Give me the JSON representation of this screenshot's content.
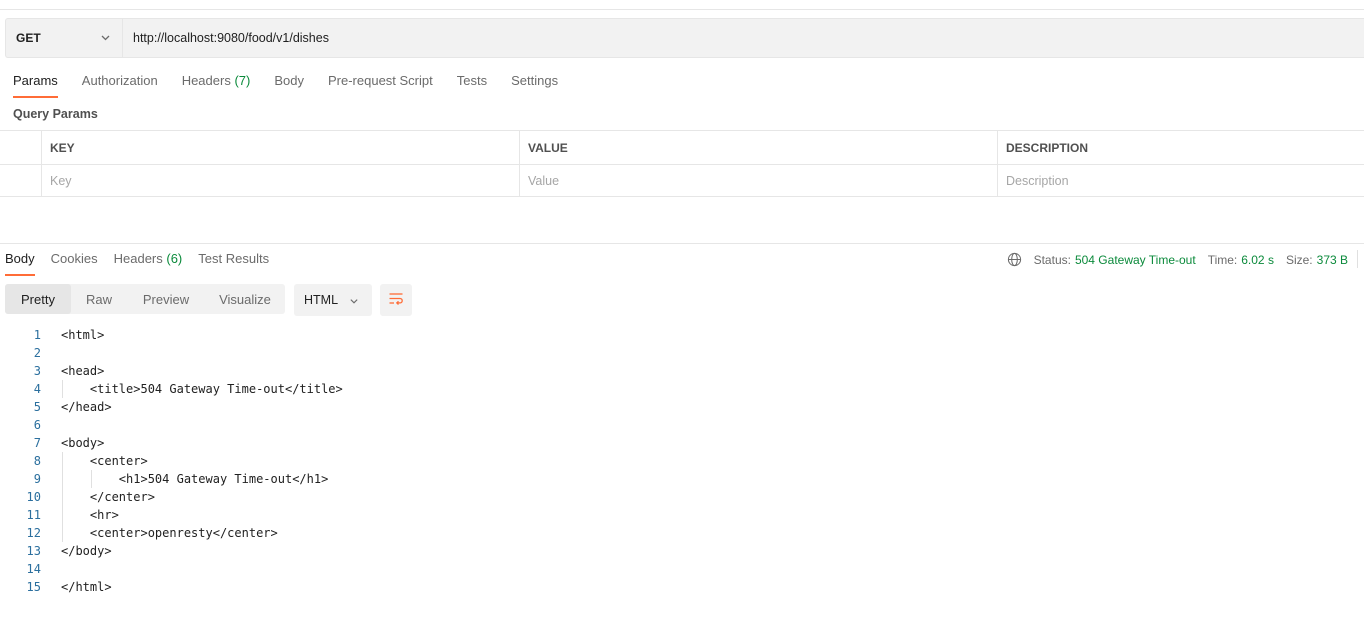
{
  "request": {
    "method": "GET",
    "url": "http://localhost:9080/food/v1/dishes"
  },
  "request_tabs": [
    {
      "label": "Params",
      "count": ""
    },
    {
      "label": "Authorization",
      "count": ""
    },
    {
      "label": "Headers",
      "count": "(7)"
    },
    {
      "label": "Body",
      "count": ""
    },
    {
      "label": "Pre-request Script",
      "count": ""
    },
    {
      "label": "Tests",
      "count": ""
    },
    {
      "label": "Settings",
      "count": ""
    }
  ],
  "query_params": {
    "title": "Query Params",
    "columns": [
      "KEY",
      "VALUE",
      "DESCRIPTION"
    ],
    "placeholders": [
      "Key",
      "Value",
      "Description"
    ]
  },
  "response_tabs": [
    {
      "label": "Body",
      "count": ""
    },
    {
      "label": "Cookies",
      "count": ""
    },
    {
      "label": "Headers",
      "count": "(6)"
    },
    {
      "label": "Test Results",
      "count": ""
    }
  ],
  "response_status": {
    "status_label": "Status:",
    "status_value": "504 Gateway Time-out",
    "time_label": "Time:",
    "time_value": "6.02 s",
    "size_label": "Size:",
    "size_value": "373 B"
  },
  "view_modes": [
    "Pretty",
    "Raw",
    "Preview",
    "Visualize"
  ],
  "format": "HTML",
  "code_lines": [
    {
      "n": "1",
      "text": "<html>"
    },
    {
      "n": "2",
      "text": ""
    },
    {
      "n": "3",
      "text": "<head>"
    },
    {
      "n": "4",
      "text": "    <title>504 Gateway Time-out</title>"
    },
    {
      "n": "5",
      "text": "</head>"
    },
    {
      "n": "6",
      "text": ""
    },
    {
      "n": "7",
      "text": "<body>"
    },
    {
      "n": "8",
      "text": "    <center>"
    },
    {
      "n": "9",
      "text": "        <h1>504 Gateway Time-out</h1>"
    },
    {
      "n": "10",
      "text": "    </center>"
    },
    {
      "n": "11",
      "text": "    <hr>"
    },
    {
      "n": "12",
      "text": "    <center>openresty</center>"
    },
    {
      "n": "13",
      "text": "</body>"
    },
    {
      "n": "14",
      "text": ""
    },
    {
      "n": "15",
      "text": "</html>"
    }
  ],
  "colors": {
    "accent": "#ff6c37",
    "success": "#0b8a3b",
    "line_number": "#2b6f9e"
  },
  "icons": {
    "globe": "globe-icon",
    "wrap": "wrap-lines-icon",
    "chevron": "chevron-down-icon"
  }
}
